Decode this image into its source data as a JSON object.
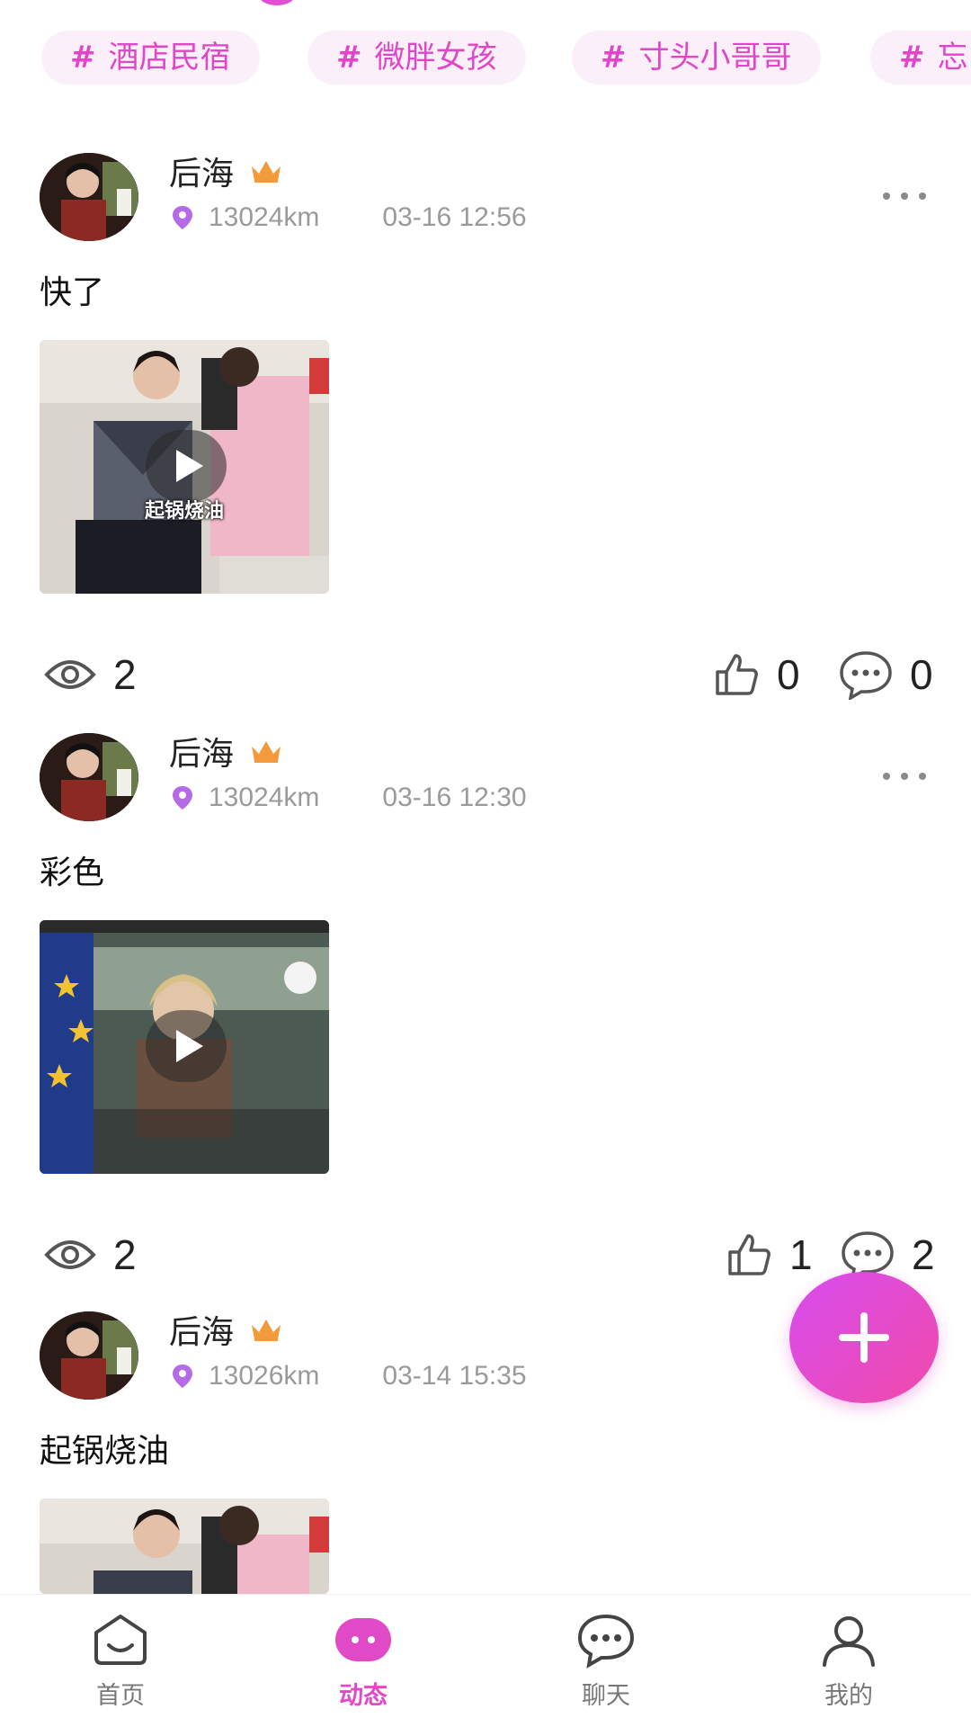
{
  "tags": [
    "酒店民宿",
    "微胖女孩",
    "寸头小哥哥",
    "忘"
  ],
  "posts": [
    {
      "user": "后海",
      "distance": "13024km",
      "time": "03-16 12:56",
      "content": "快了",
      "video_caption": "起锅烧油",
      "views": "2",
      "likes": "0",
      "comments": "0"
    },
    {
      "user": "后海",
      "distance": "13024km",
      "time": "03-16 12:30",
      "content": "彩色",
      "video_caption": "",
      "views": "2",
      "likes": "1",
      "comments": "2"
    },
    {
      "user": "后海",
      "distance": "13026km",
      "time": "03-14 15:35",
      "content": "起锅烧油",
      "video_caption": ""
    }
  ],
  "nav": {
    "home": "首页",
    "moments": "动态",
    "chat": "聊天",
    "mine": "我的",
    "active": "moments"
  },
  "icons": [
    "crown-icon",
    "location-pin-icon",
    "more-icon",
    "eye-icon",
    "thumbs-up-icon",
    "comment-icon",
    "play-icon",
    "plus-icon",
    "home-icon",
    "moments-icon",
    "chat-icon",
    "profile-icon"
  ],
  "colors": {
    "accent": "#e04ac6",
    "tag_bg": "#fbeff9",
    "crown": "#f39a3c",
    "pin": "#b56be8"
  }
}
